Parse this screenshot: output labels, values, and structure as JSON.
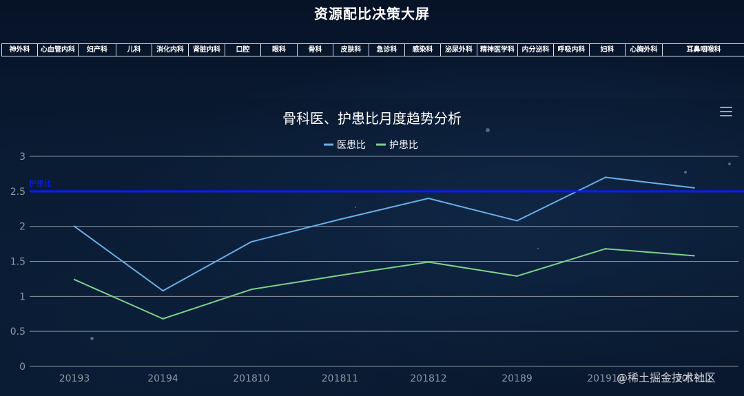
{
  "page": {
    "title": "资源配比决策大屏"
  },
  "departments": [
    "神外科",
    "心血管内科",
    "妇产科",
    "儿科",
    "消化内科",
    "肾脏内科",
    "口腔",
    "眼科",
    "骨科",
    "皮肤科",
    "急诊科",
    "感染科",
    "泌尿外科",
    "精神医学科",
    "内分泌科",
    "呼吸内科",
    "妇科",
    "心胸外科",
    "耳鼻咽喉科"
  ],
  "watermark": "@稀土掘金技术社区",
  "menu": {
    "icon": "hamburger-menu-icon"
  },
  "colors": {
    "series1": "#6aaee6",
    "series2": "#7ed08a",
    "markline": "#0a1cff",
    "grid": "#8a96a4"
  },
  "chart_data": {
    "type": "line",
    "title": "骨科医、护患比月度趋势分析",
    "categories": [
      "20193",
      "20194",
      "201810",
      "201811",
      "201812",
      "20189",
      "201910",
      "201911"
    ],
    "series": [
      {
        "name": "医患比",
        "values": [
          2.0,
          1.08,
          1.78,
          2.1,
          2.4,
          2.08,
          2.7,
          2.55
        ]
      },
      {
        "name": "护患比",
        "values": [
          1.24,
          0.68,
          1.1,
          1.3,
          1.49,
          1.29,
          1.68,
          1.58
        ]
      }
    ],
    "ylim": [
      0,
      3
    ],
    "yticks": [
      "0",
      "0.5",
      "1",
      "1.5",
      "2",
      "2.5",
      "3"
    ],
    "markline": {
      "label": "护患比",
      "value": 2.5
    },
    "grid": true,
    "legend_position": "top-center"
  }
}
